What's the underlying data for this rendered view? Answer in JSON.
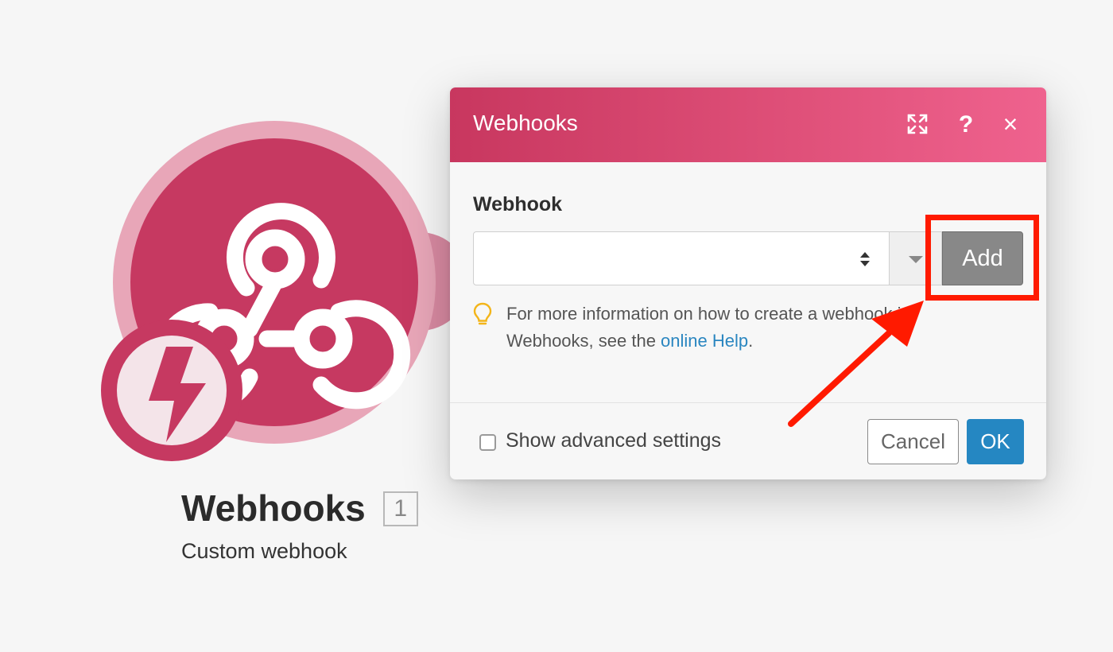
{
  "module": {
    "title": "Webhooks",
    "badge": "1",
    "subtitle": "Custom webhook",
    "icon": "webhook-icon",
    "trigger_icon": "lightning-bolt-icon",
    "colors": {
      "primary": "#c63961",
      "ring": "#e8a6b8"
    }
  },
  "dialog": {
    "title": "Webhooks",
    "header_icons": [
      "expand-icon",
      "help-icon",
      "close-icon"
    ],
    "help_glyph": "?",
    "close_glyph": "×",
    "field_label": "Webhook",
    "select_value": "",
    "add_label": "Add",
    "hint": {
      "icon": "lightbulb-icon",
      "text_before": "For more information on how to create a webhook in Webhooks, see the ",
      "link_text": "online Help",
      "text_after": "."
    },
    "advanced_label": "Show advanced settings",
    "advanced_checked": false,
    "cancel_label": "Cancel",
    "ok_label": "OK",
    "colors": {
      "header_start": "#c8375f",
      "header_end": "#ef628e",
      "ok": "#2587c2",
      "link": "#2a86c0"
    }
  },
  "annotation": {
    "type": "highlight-with-arrow",
    "target": "add-button",
    "color": "#ff1a00"
  }
}
